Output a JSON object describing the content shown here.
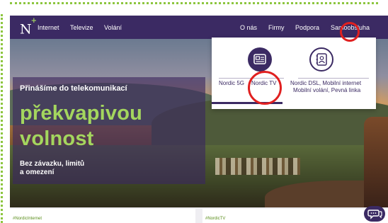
{
  "colors": {
    "brand_purple": "#3b2a63",
    "accent_green": "#a4d65e",
    "dotted_border": "#8dc63f",
    "annotation_red": "#e02020"
  },
  "navbar": {
    "logo_letter": "N",
    "logo_plus": "+",
    "left_links": [
      "Internet",
      "Televize",
      "Volání"
    ],
    "right_links": [
      "O nás",
      "Firmy",
      "Podpora",
      "Samoobsluha"
    ]
  },
  "hero": {
    "kicker": "Přinášíme do telekomunikací",
    "headline_line1": "překvapivou",
    "headline_line2": "volnost",
    "sub_line1": "Bez závazku, limitů",
    "sub_line2": "a omezení"
  },
  "dropdown": {
    "tv_icon": "tv-card-icon",
    "dsl_icon": "contact-book-icon",
    "label_nordic_5g": "Nordic 5G",
    "label_nordic_tv": "Nordic TV",
    "label_dsl_line1": "Nordic DSL, Mobilní internet",
    "label_dsl_line2": "Mobilní volání, Pevná linka"
  },
  "cards": {
    "left_tag": "#NordicInternet",
    "right_tag": "#NordicTV"
  },
  "chat": {
    "icon": "chat-support-icon"
  }
}
